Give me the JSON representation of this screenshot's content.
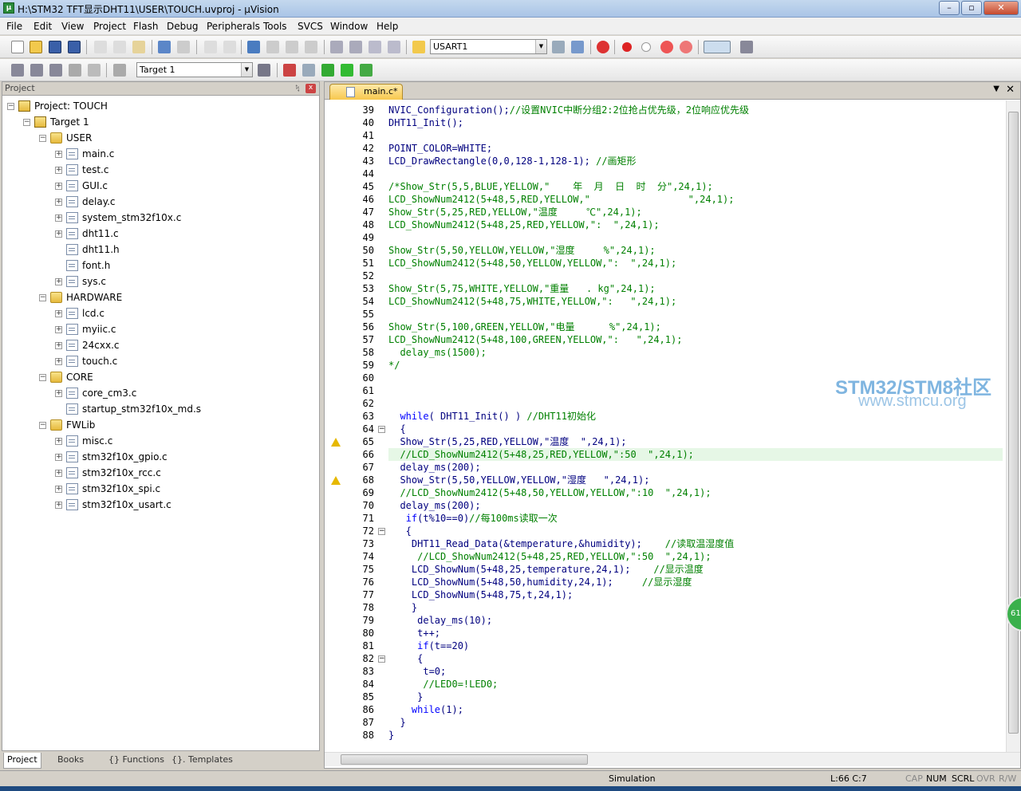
{
  "titlebar": {
    "title": "H:\\STM32 TFT显示DHT11\\USER\\TOUCH.uvproj - µVision",
    "min": "–",
    "max": "▫",
    "close": "✕"
  },
  "menu": [
    "File",
    "Edit",
    "View",
    "Project",
    "Flash",
    "Debug",
    "Peripherals",
    "Tools",
    "SVCS",
    "Window",
    "Help"
  ],
  "toolbar": {
    "find_combo": "USART1",
    "target_combo": "Target 1"
  },
  "project": {
    "header": "Project",
    "root": "Project: TOUCH",
    "target": "Target 1",
    "groups": [
      {
        "name": "USER",
        "files": [
          "main.c",
          "test.c",
          "GUI.c",
          "delay.c",
          "system_stm32f10x.c",
          "dht11.c",
          "dht11.h",
          "font.h",
          "sys.c"
        ]
      },
      {
        "name": "HARDWARE",
        "files": [
          "lcd.c",
          "myiic.c",
          "24cxx.c",
          "touch.c"
        ]
      },
      {
        "name": "CORE",
        "files": [
          "core_cm3.c",
          "startup_stm32f10x_md.s"
        ]
      },
      {
        "name": "FWLib",
        "files": [
          "misc.c",
          "stm32f10x_gpio.c",
          "stm32f10x_rcc.c",
          "stm32f10x_spi.c",
          "stm32f10x_usart.c"
        ]
      }
    ],
    "tabs": [
      "Project",
      "Books",
      "{} Functions",
      "{}. Templates"
    ]
  },
  "editor": {
    "tab": "main.c*",
    "lines": [
      {
        "n": "39",
        "t": "NVIC_Configuration();//设置NVIC中断分组2:2位抢占优先级，2位响应优先级"
      },
      {
        "n": "40",
        "t": "DHT11_Init();"
      },
      {
        "n": "41",
        "t": ""
      },
      {
        "n": "42",
        "t": "POINT_COLOR=WHITE;"
      },
      {
        "n": "43",
        "t": "LCD_DrawRectangle(0,0,128-1,128-1); //画矩形"
      },
      {
        "n": "44",
        "t": ""
      },
      {
        "n": "45",
        "t": "/*Show_Str(5,5,BLUE,YELLOW,\"    年  月  日  时  分\",24,1);"
      },
      {
        "n": "46",
        "t": "LCD_ShowNum2412(5+48,5,RED,YELLOW,\"                 \",24,1);"
      },
      {
        "n": "47",
        "t": "Show_Str(5,25,RED,YELLOW,\"温度     ℃\",24,1);"
      },
      {
        "n": "48",
        "t": "LCD_ShowNum2412(5+48,25,RED,YELLOW,\":  \",24,1);"
      },
      {
        "n": "49",
        "t": ""
      },
      {
        "n": "50",
        "t": "Show_Str(5,50,YELLOW,YELLOW,\"湿度     %\",24,1);"
      },
      {
        "n": "51",
        "t": "LCD_ShowNum2412(5+48,50,YELLOW,YELLOW,\":  \",24,1);"
      },
      {
        "n": "52",
        "t": ""
      },
      {
        "n": "53",
        "t": "Show_Str(5,75,WHITE,YELLOW,\"重量   . kg\",24,1);"
      },
      {
        "n": "54",
        "t": "LCD_ShowNum2412(5+48,75,WHITE,YELLOW,\":   \",24,1);"
      },
      {
        "n": "55",
        "t": ""
      },
      {
        "n": "56",
        "t": "Show_Str(5,100,GREEN,YELLOW,\"电量      %\",24,1);"
      },
      {
        "n": "57",
        "t": "LCD_ShowNum2412(5+48,100,GREEN,YELLOW,\":   \",24,1);"
      },
      {
        "n": "58",
        "t": "  delay_ms(1500);"
      },
      {
        "n": "59",
        "t": "*/"
      },
      {
        "n": "60",
        "t": ""
      },
      {
        "n": "61",
        "t": ""
      },
      {
        "n": "62",
        "t": ""
      },
      {
        "n": "63",
        "t": "  while( DHT11_Init() ) //DHT11初始化"
      },
      {
        "n": "64",
        "t": "  {"
      },
      {
        "n": "65",
        "t": "  Show_Str(5,25,RED,YELLOW,\"温度  \",24,1);"
      },
      {
        "n": "66",
        "t": "  //LCD_ShowNum2412(5+48,25,RED,YELLOW,\":50  \",24,1);"
      },
      {
        "n": "67",
        "t": "  delay_ms(200);"
      },
      {
        "n": "68",
        "t": "  Show_Str(5,50,YELLOW,YELLOW,\"湿度   \",24,1);"
      },
      {
        "n": "69",
        "t": "  //LCD_ShowNum2412(5+48,50,YELLOW,YELLOW,\":10  \",24,1);"
      },
      {
        "n": "70",
        "t": "  delay_ms(200);"
      },
      {
        "n": "71",
        "t": "   if(t%10==0)//每100ms读取一次"
      },
      {
        "n": "72",
        "t": "   {"
      },
      {
        "n": "73",
        "t": "    DHT11_Read_Data(&temperature,&humidity);    //读取温湿度值"
      },
      {
        "n": "74",
        "t": "     //LCD_ShowNum2412(5+48,25,RED,YELLOW,\":50  \",24,1);"
      },
      {
        "n": "75",
        "t": "    LCD_ShowNum(5+48,25,temperature,24,1);    //显示温度"
      },
      {
        "n": "76",
        "t": "    LCD_ShowNum(5+48,50,humidity,24,1);     //显示湿度"
      },
      {
        "n": "77",
        "t": "    LCD_ShowNum(5+48,75,t,24,1);"
      },
      {
        "n": "78",
        "t": "    }"
      },
      {
        "n": "79",
        "t": "     delay_ms(10);"
      },
      {
        "n": "80",
        "t": "     t++;"
      },
      {
        "n": "81",
        "t": "     if(t==20)"
      },
      {
        "n": "82",
        "t": "     {"
      },
      {
        "n": "83",
        "t": "      t=0;"
      },
      {
        "n": "84",
        "t": "      //LED0=!LED0;"
      },
      {
        "n": "85",
        "t": "     }"
      },
      {
        "n": "86",
        "t": "    while(1);"
      },
      {
        "n": "87",
        "t": "  }"
      },
      {
        "n": "88",
        "t": "}"
      }
    ]
  },
  "watermark": {
    "line1": "STM32/STM8社区",
    "line2": "www.stmcu.org"
  },
  "badge": "61",
  "status": {
    "mode": "Simulation",
    "pos": "L:66 C:7",
    "cap": "CAP",
    "num": "NUM",
    "scrl": "SCRL",
    "ovr": "OVR",
    "rw": "R/W"
  },
  "colors": {
    "comment": "#008000",
    "number": "#800080",
    "keyword": "#0000ff",
    "code": "#00007f",
    "highlight": "#e6f7e6"
  }
}
